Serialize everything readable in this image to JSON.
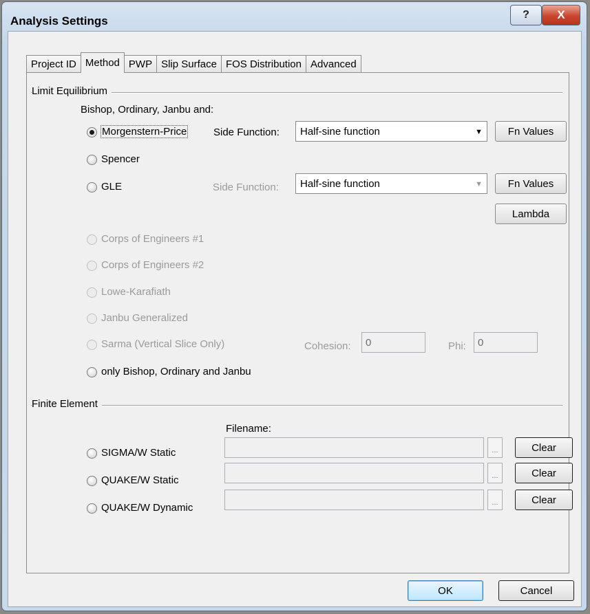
{
  "window": {
    "title": "Analysis Settings",
    "help_glyph": "?",
    "close_glyph": "X"
  },
  "tabs": [
    {
      "label": "Project ID",
      "active": false
    },
    {
      "label": "Method",
      "active": true
    },
    {
      "label": "PWP",
      "active": false
    },
    {
      "label": "Slip Surface",
      "active": false
    },
    {
      "label": "FOS Distribution",
      "active": false
    },
    {
      "label": "Advanced",
      "active": false
    }
  ],
  "limit_equilibrium": {
    "group_title": "Limit Equilibrium",
    "subtitle": "Bishop, Ordinary, Janbu and:",
    "methods": [
      {
        "label": "Morgenstern-Price",
        "checked": true,
        "enabled": true
      },
      {
        "label": "Spencer",
        "checked": false,
        "enabled": true
      },
      {
        "label": "GLE",
        "checked": false,
        "enabled": true
      },
      {
        "label": "Corps of Engineers #1",
        "checked": false,
        "enabled": false
      },
      {
        "label": "Corps of Engineers #2",
        "checked": false,
        "enabled": false
      },
      {
        "label": "Lowe-Karafiath",
        "checked": false,
        "enabled": false
      },
      {
        "label": "Janbu Generalized",
        "checked": false,
        "enabled": false
      },
      {
        "label": "Sarma (Vertical Slice Only)",
        "checked": false,
        "enabled": false
      },
      {
        "label": "only Bishop, Ordinary and Janbu",
        "checked": false,
        "enabled": true
      }
    ],
    "side_function_label": "Side Function:",
    "side_function_value": "Half-sine function",
    "gle_side_function_label": "Side Function:",
    "gle_side_function_value": "Half-sine function",
    "fn_values_label": "Fn Values",
    "lambda_label": "Lambda",
    "cohesion_label": "Cohesion:",
    "cohesion_value": "0",
    "phi_label": "Phi:",
    "phi_value": "0"
  },
  "finite_element": {
    "group_title": "Finite Element",
    "filename_label": "Filename:",
    "rows": [
      {
        "label": "SIGMA/W Static",
        "filename": "",
        "browse": "...",
        "clear": "Clear"
      },
      {
        "label": "QUAKE/W Static",
        "filename": "",
        "browse": "...",
        "clear": "Clear"
      },
      {
        "label": "QUAKE/W Dynamic",
        "filename": "",
        "browse": "...",
        "clear": "Clear"
      }
    ]
  },
  "footer": {
    "ok_label": "OK",
    "cancel_label": "Cancel"
  }
}
